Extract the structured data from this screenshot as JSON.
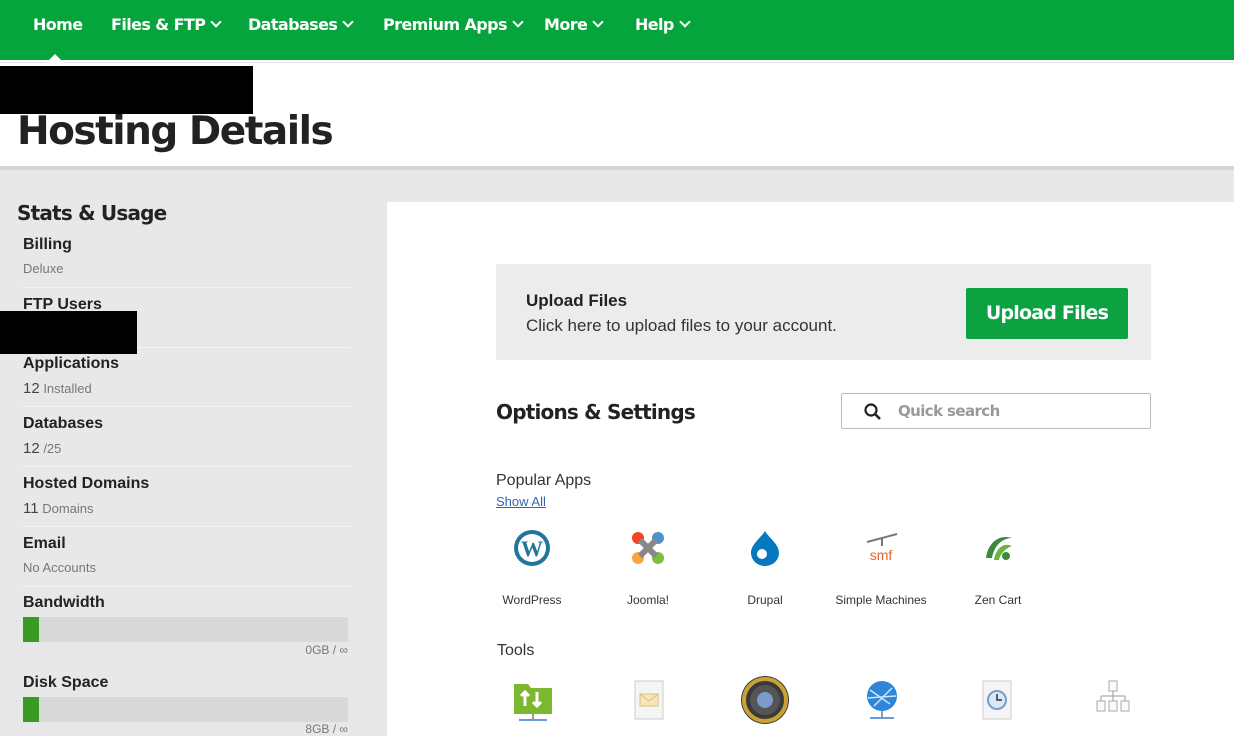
{
  "nav": {
    "items": [
      {
        "label": "Home"
      },
      {
        "label": "Files & FTP"
      },
      {
        "label": "Databases"
      },
      {
        "label": "Premium Apps"
      },
      {
        "label": "More"
      },
      {
        "label": "Help"
      }
    ]
  },
  "header": {
    "title": "Hosting Details"
  },
  "sidebar": {
    "title": "Stats & Usage",
    "stats": [
      {
        "label": "Billing",
        "value": "Deluxe"
      },
      {
        "label": "FTP Users"
      },
      {
        "label": "Applications",
        "count": "12",
        "unit": "Installed"
      },
      {
        "label": "Databases",
        "count": "12",
        "unit": "/25"
      },
      {
        "label": "Hosted Domains",
        "count": "11",
        "unit": "Domains"
      },
      {
        "label": "Email",
        "value": "No Accounts"
      }
    ],
    "bandwidth": {
      "label": "Bandwidth",
      "usage": "0GB / ∞",
      "fill_percent": 5
    },
    "disk": {
      "label": "Disk Space",
      "usage": "8GB / ∞",
      "fill_percent": 5
    }
  },
  "upload": {
    "heading": "Upload Files",
    "description": "Click here to upload files to your account.",
    "button": "Upload Files"
  },
  "options": {
    "title": "Options & Settings",
    "search_placeholder": "Quick search"
  },
  "popular_apps": {
    "title": "Popular Apps",
    "show_all": "Show All",
    "apps": [
      {
        "name": "WordPress"
      },
      {
        "name": "Joomla!"
      },
      {
        "name": "Drupal"
      },
      {
        "name": "Simple Machines"
      },
      {
        "name": "Zen Cart"
      }
    ]
  },
  "tools": {
    "title": "Tools"
  },
  "colors": {
    "brand": "#06a43c",
    "progress": "#3b9a22"
  }
}
